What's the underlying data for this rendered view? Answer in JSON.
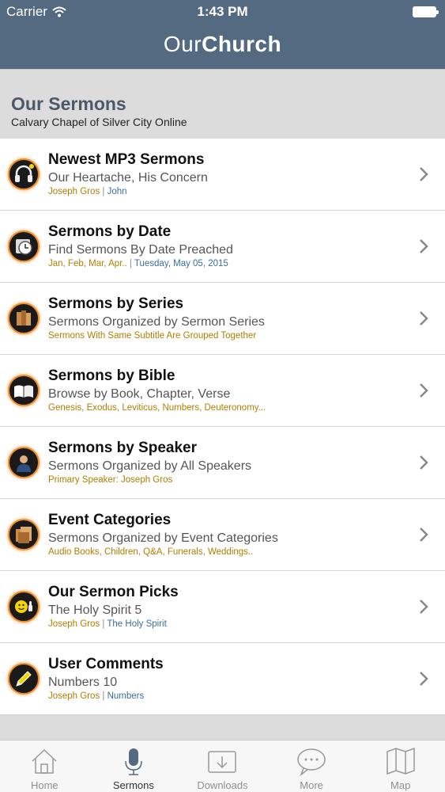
{
  "status_bar": {
    "carrier": "Carrier",
    "time": "1:43 PM"
  },
  "app": {
    "title_light": "Our",
    "title_bold": "Church"
  },
  "section": {
    "title": "Our Sermons",
    "subtitle": "Calvary Chapel of Silver City Online"
  },
  "items": [
    {
      "title": "Newest MP3 Sermons",
      "subtitle": "Our Heartache, His Concern",
      "meta1": "Joseph Gros",
      "meta2": "John",
      "icon": "headphones-icon"
    },
    {
      "title": "Sermons by Date",
      "subtitle": "Find Sermons By Date Preached",
      "meta1": "Jan, Feb, Mar, Apr..",
      "meta2": "Tuesday, May 05, 2015",
      "icon": "clock-calendar-icon"
    },
    {
      "title": "Sermons by Series",
      "subtitle": "Sermons Organized by Sermon Series",
      "meta1": "Sermons With Same Subtitle Are Grouped Together",
      "meta2": "",
      "icon": "books-icon"
    },
    {
      "title": "Sermons by Bible",
      "subtitle": "Browse by Book, Chapter, Verse",
      "meta1": "Genesis, Exodus, Leviticus, Numbers, Deuteronomy...",
      "meta2": "",
      "icon": "open-bible-icon"
    },
    {
      "title": "Sermons by Speaker",
      "subtitle": "Sermons Organized by All Speakers",
      "meta1": "Primary Speaker: Joseph Gros",
      "meta2": "",
      "icon": "speaker-person-icon"
    },
    {
      "title": "Event Categories",
      "subtitle": "Sermons Organized by Event Categories",
      "meta1": "Audio Books, Children, Q&A, Funerals, Weddings..",
      "meta2": "",
      "icon": "folders-icon"
    },
    {
      "title": "Our Sermon Picks",
      "subtitle": "The Holy Spirit 5",
      "meta1": "Joseph Gros",
      "meta2": "The Holy Spirit",
      "icon": "thumbs-up-smiley-icon"
    },
    {
      "title": "User Comments",
      "subtitle": "Numbers 10",
      "meta1": "Joseph Gros",
      "meta2": "Numbers",
      "icon": "pencil-icon"
    }
  ],
  "tabs": [
    {
      "label": "Home",
      "icon": "house-icon",
      "active": false
    },
    {
      "label": "Sermons",
      "icon": "microphone-icon",
      "active": true
    },
    {
      "label": "Downloads",
      "icon": "download-tray-icon",
      "active": false
    },
    {
      "label": "More",
      "icon": "speech-bubble-icon",
      "active": false
    },
    {
      "label": "Map",
      "icon": "map-icon",
      "active": false
    }
  ],
  "colors": {
    "header": "#536a80",
    "accent_orange": "#ef8f2a",
    "meta_gold": "#b07e00",
    "meta_blue": "#3a6e9c"
  }
}
